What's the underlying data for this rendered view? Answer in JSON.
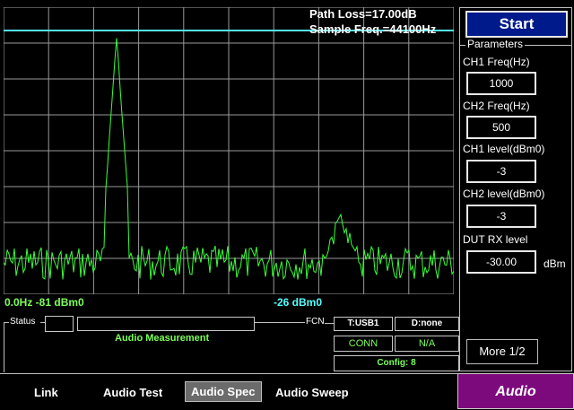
{
  "spectrum": {
    "path_loss": "Path Loss=17.00dB",
    "sample_freq": "Sample Freq.=44100Hz",
    "left_label": "0.0Hz -81 dBm0",
    "center_label": "-26 dBm0",
    "trace_color": "#39ff39",
    "ref_line_color": "#55e6f2"
  },
  "control": {
    "start_label": "Start",
    "parameters_title": "Parameters",
    "ch1_freq_label": "CH1 Freq(Hz)",
    "ch1_freq_value": "1000",
    "ch2_freq_label": "CH2 Freq(Hz)",
    "ch2_freq_value": "500",
    "ch1_level_label": "CH1 level(dBm0)",
    "ch1_level_value": "-3",
    "ch2_level_label": "CH2 level(dBm0)",
    "ch2_level_value": "-3",
    "dut_rx_label": "DUT RX level",
    "dut_rx_value": "-30.00",
    "dut_rx_unit": "dBm",
    "more_label": "More 1/2"
  },
  "status": {
    "status_label": "Status",
    "measurement_text": "Audio Measurement",
    "fcn_label": "FCN",
    "transport": "T:USB1",
    "device": "D:none",
    "conn": "CONN",
    "na": "N/A",
    "config": "Config: 8"
  },
  "tabs": [
    {
      "label": "Link"
    },
    {
      "label": "Audio Test"
    },
    {
      "label": "Audio Spec"
    },
    {
      "label": "Audio Sweep"
    }
  ],
  "mode_label": "Audio"
}
